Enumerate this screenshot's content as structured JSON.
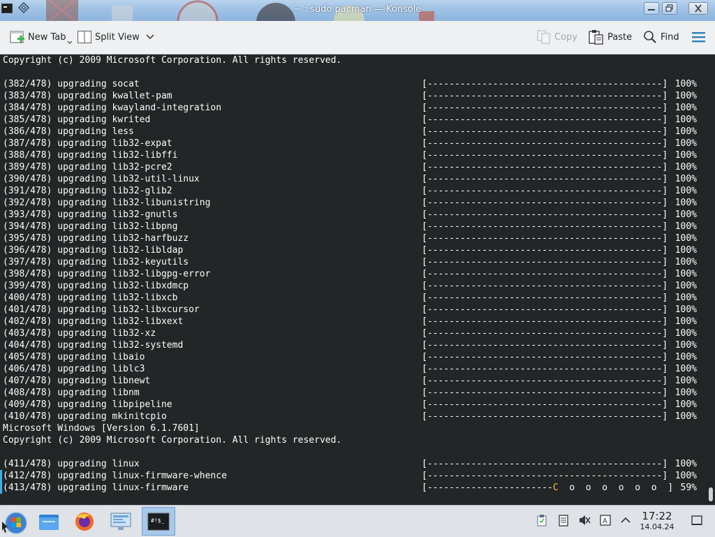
{
  "window": {
    "title": "~ : sudo pacman — Konsole"
  },
  "toolbar": {
    "new_tab": "New Tab",
    "split_view": "Split View",
    "copy": "Copy",
    "paste": "Paste",
    "find": "Find"
  },
  "terminal": {
    "lines": [
      {
        "text": "Copyright (c) 2009 Microsoft Corporation. All rights reserved."
      },
      {
        "text": ""
      },
      {
        "text": "(382/478) upgrading socat",
        "bar": "[-------------------------------------------]",
        "pct": "100%"
      },
      {
        "text": "(383/478) upgrading kwallet-pam",
        "bar": "[-------------------------------------------]",
        "pct": "100%"
      },
      {
        "text": "(384/478) upgrading kwayland-integration",
        "bar": "[-------------------------------------------]",
        "pct": "100%"
      },
      {
        "text": "(385/478) upgrading kwrited",
        "bar": "[-------------------------------------------]",
        "pct": "100%"
      },
      {
        "text": "(386/478) upgrading less",
        "bar": "[-------------------------------------------]",
        "pct": "100%"
      },
      {
        "text": "(387/478) upgrading lib32-expat",
        "bar": "[-------------------------------------------]",
        "pct": "100%"
      },
      {
        "text": "(388/478) upgrading lib32-libffi",
        "bar": "[-------------------------------------------]",
        "pct": "100%"
      },
      {
        "text": "(389/478) upgrading lib32-pcre2",
        "bar": "[-------------------------------------------]",
        "pct": "100%"
      },
      {
        "text": "(390/478) upgrading lib32-util-linux",
        "bar": "[-------------------------------------------]",
        "pct": "100%"
      },
      {
        "text": "(391/478) upgrading lib32-glib2",
        "bar": "[-------------------------------------------]",
        "pct": "100%"
      },
      {
        "text": "(392/478) upgrading lib32-libunistring",
        "bar": "[-------------------------------------------]",
        "pct": "100%"
      },
      {
        "text": "(393/478) upgrading lib32-gnutls",
        "bar": "[-------------------------------------------]",
        "pct": "100%"
      },
      {
        "text": "(394/478) upgrading lib32-libpng",
        "bar": "[-------------------------------------------]",
        "pct": "100%"
      },
      {
        "text": "(395/478) upgrading lib32-harfbuzz",
        "bar": "[-------------------------------------------]",
        "pct": "100%"
      },
      {
        "text": "(396/478) upgrading lib32-libldap",
        "bar": "[-------------------------------------------]",
        "pct": "100%"
      },
      {
        "text": "(397/478) upgrading lib32-keyutils",
        "bar": "[-------------------------------------------]",
        "pct": "100%"
      },
      {
        "text": "(398/478) upgrading lib32-libgpg-error",
        "bar": "[-------------------------------------------]",
        "pct": "100%"
      },
      {
        "text": "(399/478) upgrading lib32-libxdmcp",
        "bar": "[-------------------------------------------]",
        "pct": "100%"
      },
      {
        "text": "(400/478) upgrading lib32-libxcb",
        "bar": "[-------------------------------------------]",
        "pct": "100%"
      },
      {
        "text": "(401/478) upgrading lib32-libxcursor",
        "bar": "[-------------------------------------------]",
        "pct": "100%"
      },
      {
        "text": "(402/478) upgrading lib32-libxext",
        "bar": "[-------------------------------------------]",
        "pct": "100%"
      },
      {
        "text": "(403/478) upgrading lib32-xz",
        "bar": "[-------------------------------------------]",
        "pct": "100%"
      },
      {
        "text": "(404/478) upgrading lib32-systemd",
        "bar": "[-------------------------------------------]",
        "pct": "100%"
      },
      {
        "text": "(405/478) upgrading libaio",
        "bar": "[-------------------------------------------]",
        "pct": "100%"
      },
      {
        "text": "(406/478) upgrading liblc3",
        "bar": "[-------------------------------------------]",
        "pct": "100%"
      },
      {
        "text": "(407/478) upgrading libnewt",
        "bar": "[-------------------------------------------]",
        "pct": "100%"
      },
      {
        "text": "(408/478) upgrading libnm",
        "bar": "[-------------------------------------------]",
        "pct": "100%"
      },
      {
        "text": "(409/478) upgrading libpipeline",
        "bar": "[-------------------------------------------]",
        "pct": "100%"
      },
      {
        "text": "(410/478) upgrading mkinitcpio",
        "bar": "[-------------------------------------------]",
        "pct": "100%"
      },
      {
        "text": "Microsoft Windows [Version 6.1.7601]"
      },
      {
        "text": "Copyright (c) 2009 Microsoft Corporation. All rights reserved."
      },
      {
        "text": ""
      },
      {
        "text": "(411/478) upgrading linux",
        "bar": "[-------------------------------------------]",
        "pct": "100%"
      },
      {
        "text": "(412/478) upgrading linux-firmware-whence",
        "bar": "[-------------------------------------------]",
        "pct": "100%"
      },
      {
        "text": "(413/478) upgrading linux-firmware",
        "bar_done": "[-----------------------",
        "bar_pac": "C",
        "bar_rest": "  o  o  o  o  o  o  ]",
        "pct": "59%"
      }
    ]
  },
  "clock": {
    "time": "17:22",
    "date": "14.04.24"
  }
}
